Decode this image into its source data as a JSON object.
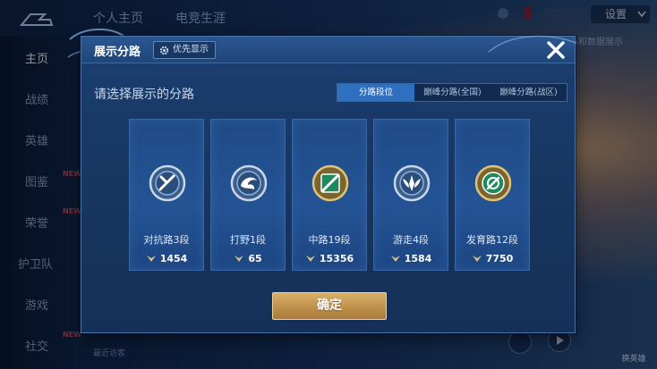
{
  "background": {
    "top_tabs": [
      "个人主页",
      "电竞生涯"
    ],
    "settings_label": "设置",
    "data_text": "和数据展示",
    "sidebar": [
      {
        "label": "主页",
        "active": true,
        "new": false
      },
      {
        "label": "战绩",
        "active": false,
        "new": false
      },
      {
        "label": "英雄",
        "active": false,
        "new": false
      },
      {
        "label": "图鉴",
        "active": false,
        "new": true
      },
      {
        "label": "荣誉",
        "active": false,
        "new": true
      },
      {
        "label": "护卫队",
        "active": false,
        "new": false
      },
      {
        "label": "游戏",
        "active": false,
        "new": false
      },
      {
        "label": "社交",
        "active": false,
        "new": true
      }
    ],
    "new_badge": "NEW",
    "recent_visitor": "最近访客",
    "switch_hero_label": "换英雄"
  },
  "modal": {
    "title": "展示分路",
    "priority_label": "优先显示",
    "prompt": "请选择展示的分路",
    "tabs": [
      {
        "label": "分路段位",
        "active": true
      },
      {
        "label": "巅峰分路(全国)",
        "active": false
      },
      {
        "label": "巅峰分路(战区)",
        "active": false
      }
    ],
    "lanes": [
      {
        "label": "对抗路3段",
        "score": "1454",
        "icon": "clash-lane-icon",
        "accent": "#c9d6e6"
      },
      {
        "label": "打野1段",
        "score": "65",
        "icon": "jungle-icon",
        "accent": "#c9d6e6"
      },
      {
        "label": "中路19段",
        "score": "15356",
        "icon": "mid-lane-icon",
        "accent": "#3fb07a"
      },
      {
        "label": "游走4段",
        "score": "1584",
        "icon": "roam-icon",
        "accent": "#c9d6e6"
      },
      {
        "label": "发育路12段",
        "score": "7750",
        "icon": "farm-lane-icon",
        "accent": "#3fb07a"
      }
    ],
    "confirm_label": "确定"
  },
  "colors": {
    "modal_bg": "#17355f",
    "active_tab": "#2e6fc0",
    "confirm_gold": "#c2944e",
    "score_icon": "#d9c38a"
  }
}
